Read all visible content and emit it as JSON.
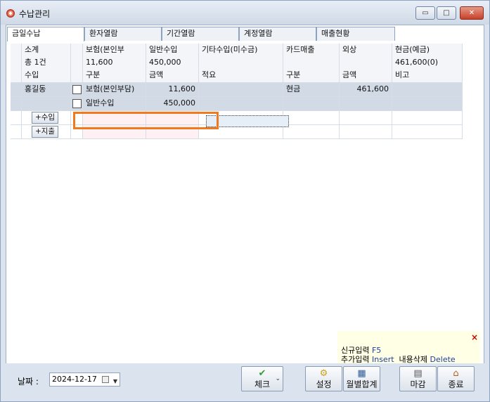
{
  "window": {
    "title": "수납관리",
    "min_glyph": "▭",
    "max_glyph": "□",
    "close_glyph": "✕"
  },
  "tabs": [
    "금일수납",
    "환자열람",
    "기간열람",
    "계정열람",
    "매출현황"
  ],
  "grid": {
    "header1": [
      "소계",
      "보험(본인부",
      "일반수입",
      "기타수입(미수금)",
      "카드매출",
      "외상",
      "현금(예금)"
    ],
    "header2": [
      "총 1건",
      "11,600",
      "450,000",
      "",
      "",
      "",
      "461,600(0)"
    ],
    "header3": [
      "수입",
      "구분",
      "금액",
      "적요",
      "구분",
      "금액",
      "비고"
    ],
    "row1": {
      "name": "홍길동",
      "category": "보험(본인부담)",
      "amount": "11,600",
      "memo": "",
      "pay_type": "현금",
      "pay_amount": "461,600",
      "note": ""
    },
    "row2": {
      "category": "일반수입",
      "amount": "450,000"
    },
    "add_income": "+수입",
    "add_expense": "+지출"
  },
  "help": {
    "close": "×",
    "line1_label": "신규입력",
    "line1_key": "F5",
    "line2_label": "추가입력",
    "line2_key": "Insert",
    "line3_label": "내용삭제",
    "line3_key": "Delete"
  },
  "bottom": {
    "date_label": "날짜 :",
    "date_value": "2024-12-17",
    "check_icon": "✔",
    "check_label": "체크",
    "settings_icon": "⚙",
    "settings_label": "설정",
    "monthly_icon": "▦",
    "monthly_label": "월별합계",
    "close_day_icon": "▤",
    "close_day_label": "마감",
    "exit_icon": "⌂",
    "exit_label": "종료"
  }
}
